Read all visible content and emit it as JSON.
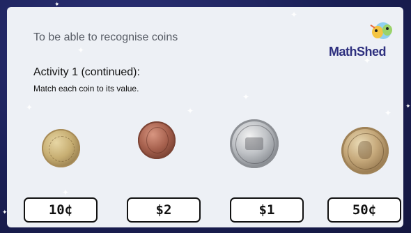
{
  "header": {
    "objective": "To be able to recognise coins",
    "logo_text": "MathShed"
  },
  "activity": {
    "title": "Activity 1 (continued):",
    "instruction": "Match each coin to its value."
  },
  "coins": [
    {
      "name": "10c coin"
    },
    {
      "name": "$2 coin"
    },
    {
      "name": "50c coin"
    },
    {
      "name": "$1 coin"
    }
  ],
  "value_boxes": [
    "10¢",
    "$2",
    "$1",
    "50¢"
  ],
  "colors": {
    "background": "#1a1f55",
    "panel": "#edf0f5",
    "logo": "#2d2f7e"
  }
}
